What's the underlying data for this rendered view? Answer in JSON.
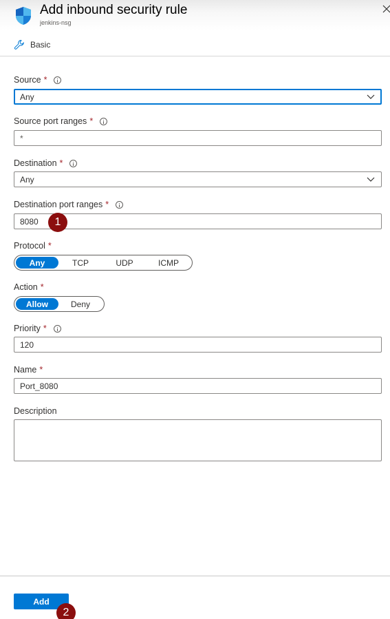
{
  "header": {
    "title": "Add inbound security rule",
    "subtitle": "jenkins-nsg",
    "icon": "shield-icon",
    "close_icon": "close-icon"
  },
  "mode": {
    "label": "Basic",
    "icon": "wrench-icon"
  },
  "colors": {
    "accent": "#0078d4",
    "required": "#a4262c",
    "badge": "#8b0e0e"
  },
  "form": {
    "source": {
      "label": "Source",
      "required": "*",
      "value": "Any"
    },
    "source_port_ranges": {
      "label": "Source port ranges",
      "required": "*",
      "value": "*"
    },
    "destination": {
      "label": "Destination",
      "required": "*",
      "value": "Any"
    },
    "destination_port_ranges": {
      "label": "Destination port ranges",
      "required": "*",
      "value": "8080"
    },
    "protocol": {
      "label": "Protocol",
      "required": "*",
      "options": [
        "Any",
        "TCP",
        "UDP",
        "ICMP"
      ],
      "selected": "Any"
    },
    "action": {
      "label": "Action",
      "required": "*",
      "options": [
        "Allow",
        "Deny"
      ],
      "selected": "Allow"
    },
    "priority": {
      "label": "Priority",
      "required": "*",
      "value": "120"
    },
    "name": {
      "label": "Name",
      "required": "*",
      "value": "Port_8080"
    },
    "description": {
      "label": "Description",
      "value": ""
    }
  },
  "footer": {
    "add_label": "Add"
  },
  "annotations": {
    "badge1": "1",
    "badge2": "2"
  }
}
